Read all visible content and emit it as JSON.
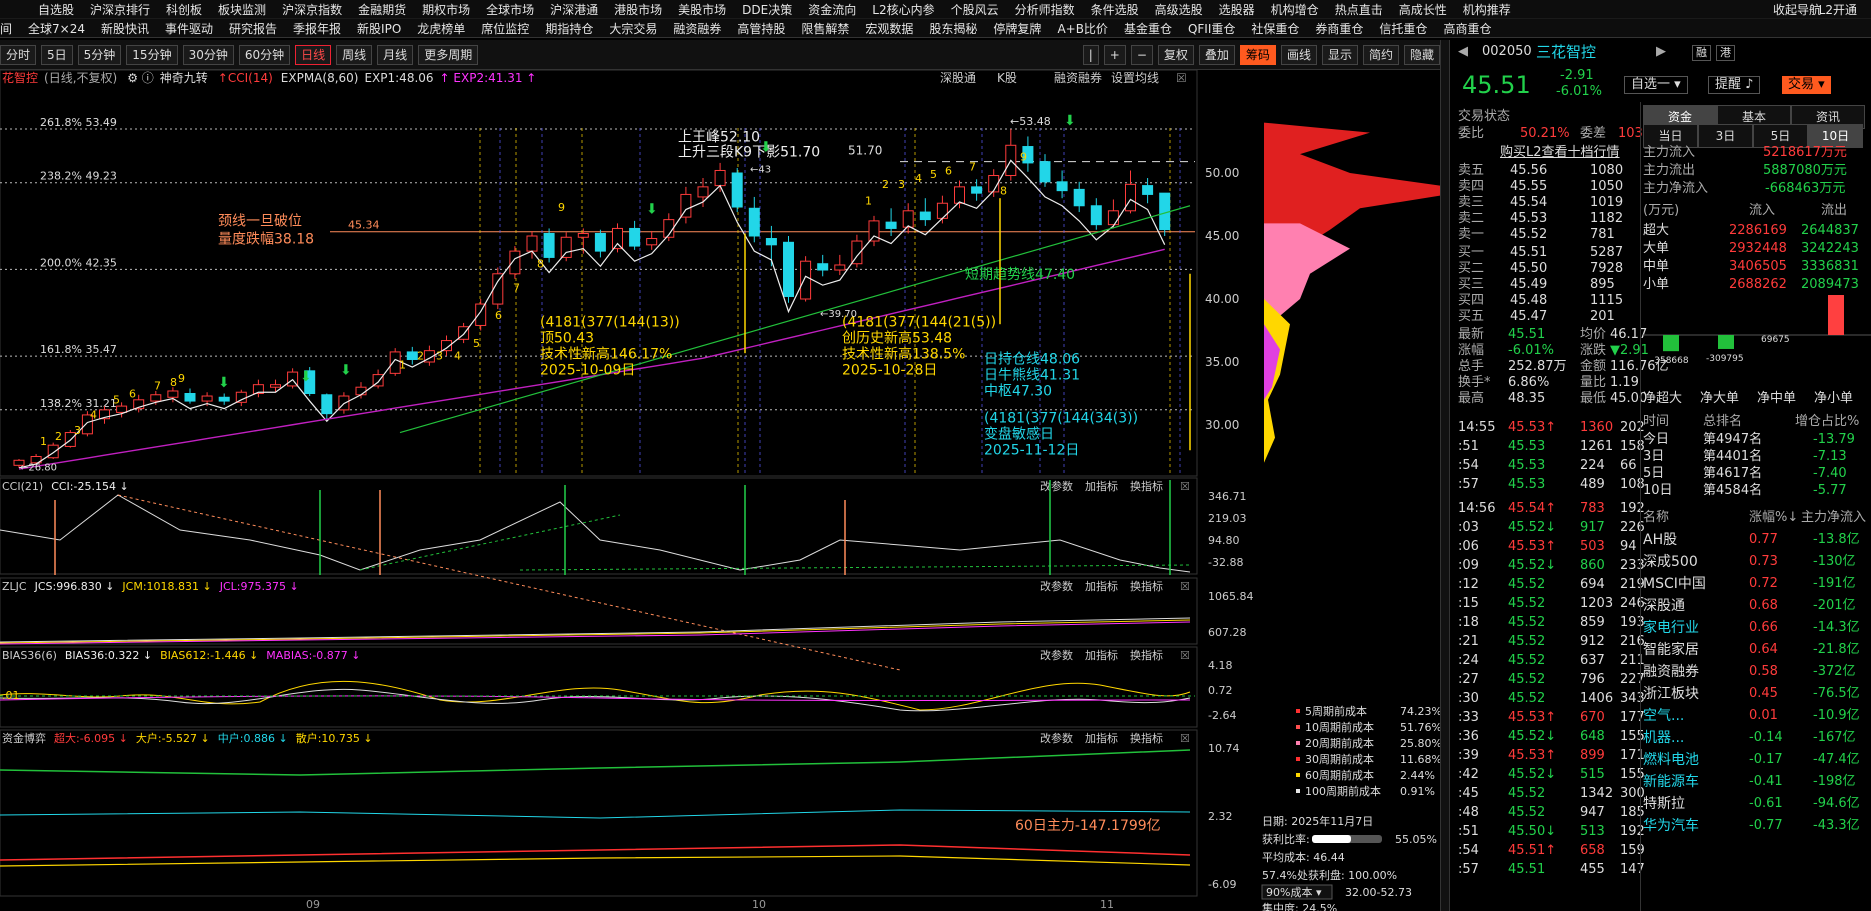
{
  "menu1": [
    "自选股",
    "沪深京排行",
    "科创板",
    "板块监测",
    "沪深京指数",
    "金融期货",
    "期权市场",
    "全球市场",
    "沪深港通",
    "港股市场",
    "美股市场",
    "DDE决策",
    "资金流向",
    "L2核心内参",
    "个股风云",
    "分析师指数",
    "条件选股",
    "高级选股",
    "选股器",
    "机构增仓",
    "热点直击",
    "高成长性",
    "机构推荐"
  ],
  "menu1_right": [
    "收起导航",
    "L2开通"
  ],
  "menu2": [
    "全球7×24",
    "新股快讯",
    "事件驱动",
    "研究报告",
    "季报年报",
    "新股IPO",
    "龙虎榜单",
    "席位监控",
    "期指持仓",
    "大宗交易",
    "融资融券",
    "高管持股",
    "限售解禁",
    "宏观数据",
    "股东揭秘",
    "停牌复牌",
    "A+B比价",
    "基金重仓",
    "QFII重仓",
    "社保重仓",
    "券商重仓",
    "信托重仓",
    "高商重仓"
  ],
  "menu2_left_cut": [
    "间"
  ],
  "toolbar": {
    "items": [
      "分时",
      "5日",
      "5分钟",
      "15分钟",
      "30分钟",
      "60分钟",
      "日线",
      "周线",
      "月线",
      "更多周期"
    ],
    "active": "日线",
    "right": [
      "|",
      "+",
      "−",
      "复权",
      "叠加",
      "筹码",
      "画线",
      "显示",
      "简约",
      "隐藏"
    ],
    "hot": "筹码"
  },
  "chart": {
    "name": "花智控",
    "subtitle": "(日线,不复权)",
    "shenqi": "神奇九转",
    "cci_tag": "CCI(14)",
    "expma": "EXPMA(8,60)",
    "exp1": "EXP1:48.06",
    "exp2": "EXP2:41.31",
    "top_links": [
      "深股通",
      "K股",
      "融资融券",
      "设置均线"
    ],
    "y_labels": [
      "50.00",
      "45.00",
      "40.00",
      "35.00",
      "30.00"
    ],
    "fib": [
      "261.8% 53.49",
      "238.2% 49.23",
      "200.0% 42.35",
      "161.8% 35.47",
      "138.2% 31.21",
      "1.00"
    ],
    "notes": {
      "neck": "颈线一旦破位",
      "neck2": "量度跌幅38.18",
      "neck_val": "45.34",
      "top1": "上王峰52.10",
      "top2": "上升三段K9下影51.70",
      "p5170": "51.70",
      "p5348": "←53.48",
      "sq1": "(4181(377(144(13))",
      "sq1b": "顶50.43",
      "sq1c": "技术性新高146.17%",
      "sq1d": "2025-10-09日",
      "sq2": "(4181(377(144(21(5))",
      "sq2b": "创历史新高53.48",
      "sq2c": "技术性新高138.5%",
      "sq2d": "2025-10-28日",
      "short": "短期趋势线47.40",
      "lines": "日持仓线48.06",
      "lines2": "日牛熊线41.31",
      "lines3": "中枢47.30",
      "sq3": "(4181(377(144(34(3))",
      "sq3b": "变盘敏感日",
      "sq3c": "2025-11-12日",
      "low": "←39.70",
      "low2": "←26.80",
      "p43": "←43"
    },
    "chart_data": {
      "type": "candlestick",
      "x_axis": [
        "09",
        "10",
        "11"
      ],
      "note": "approximate daily candles"
    },
    "cost_legend": [
      [
        "5周期前成本",
        "74.23%"
      ],
      [
        "10周期前成本",
        "51.76%"
      ],
      [
        "20周期前成本",
        "25.80%"
      ],
      [
        "30周期前成本",
        "11.68%"
      ],
      [
        "60周期前成本",
        "2.44%"
      ],
      [
        "100周期前成本",
        "0.91%"
      ]
    ],
    "chip_info": {
      "date": "日期: 2025年11月7日",
      "ratio": "获利比率:",
      "ratio_val": "55.05%",
      "avg": "平均成本: 46.44",
      "range": "57.4%处获利盘: 100.00%",
      "cost90": "90%成本",
      "cost_range": "32.00-52.73",
      "conc": "集中度: 24.5%"
    }
  },
  "panels": [
    {
      "name": "CCI",
      "title": "CCI(21)",
      "vals": [
        {
          "t": "CCI:-25.154",
          "c": "wht"
        }
      ],
      "y": [
        "346.71",
        "219.03",
        "94.80",
        "-32.88"
      ],
      "btn": [
        "改参数",
        "加指标",
        "换指标"
      ]
    },
    {
      "name": "ZLJC",
      "title": "ZLJC",
      "vals": [
        {
          "t": "JCS:996.830",
          "c": "wht"
        },
        {
          "t": "JCM:1018.831",
          "c": "yel"
        },
        {
          "t": "JCL:975.375",
          "c": "mag"
        }
      ],
      "y": [
        "1065.84",
        "607.28"
      ],
      "btn": [
        "改参数",
        "加指标",
        "换指标"
      ]
    },
    {
      "name": "BIAS",
      "title": "BIAS36(6)",
      "vals": [
        {
          "t": "BIAS36:0.322",
          "c": "wht"
        },
        {
          "t": "BIAS612:-1.446",
          "c": "yel"
        },
        {
          "t": "MABIAS:-0.877",
          "c": "mag"
        }
      ],
      "y": [
        "4.18",
        "0.72",
        "-2.64"
      ],
      "btn": [
        "改参数",
        "加指标",
        "换指标"
      ]
    },
    {
      "name": "ZJBY",
      "title": "资金博弈",
      "vals": [
        {
          "t": "超大:-6.095",
          "c": "red"
        },
        {
          "t": "大户:-5.527",
          "c": "yel"
        },
        {
          "t": "中户:0.886",
          "c": "cyn"
        },
        {
          "t": "散户:10.735",
          "c": "yel"
        }
      ],
      "y": [
        "10.74",
        "2.32",
        "-6.09"
      ],
      "btn": [
        "改参数",
        "加指标",
        "换指标"
      ],
      "note": "60日主力-147.1799亿"
    }
  ],
  "stock": {
    "code": "002050",
    "name": "三花智控",
    "tags": [
      "融",
      "港"
    ],
    "price": "45.51",
    "chg": "-2.91",
    "pct": "-6.01%",
    "btn": [
      "自选一",
      "提醒",
      "交易"
    ],
    "status_l": "交易状态",
    "status_r": "已收市",
    "weibi": "委比",
    "weibi_v": "50.21%",
    "weicha": "委差",
    "weicha_v": "10313",
    "l2": "购买L2查看十档行情",
    "asks": [
      [
        "卖五",
        "45.56",
        "1080"
      ],
      [
        "卖四",
        "45.55",
        "1050"
      ],
      [
        "卖三",
        "45.54",
        "1019"
      ],
      [
        "卖二",
        "45.53",
        "1182"
      ],
      [
        "卖一",
        "45.52",
        "781"
      ]
    ],
    "bids": [
      [
        "买一",
        "45.51",
        "5287"
      ],
      [
        "买二",
        "45.50",
        "7928"
      ],
      [
        "买三",
        "45.49",
        "895"
      ],
      [
        "买四",
        "45.48",
        "1115"
      ],
      [
        "买五",
        "45.47",
        "201"
      ]
    ],
    "stats": [
      [
        "最新",
        "45.51",
        "均价",
        "46.17"
      ],
      [
        "涨幅",
        "-6.01%",
        "涨跌",
        "▼2.91"
      ],
      [
        "总手",
        "252.87万",
        "金额",
        "116.76亿"
      ],
      [
        "换手*",
        "6.86%",
        "量比",
        "1.19"
      ],
      [
        "最高",
        "48.35",
        "最低",
        "45.00"
      ]
    ],
    "ticks": [
      [
        "14:55",
        "45.53",
        "↑",
        "1360",
        "202"
      ],
      [
        ":51",
        "45.53",
        "",
        "1261",
        "158"
      ],
      [
        ":54",
        "45.53",
        "",
        "224",
        "66"
      ],
      [
        ":57",
        "45.53",
        "",
        "489",
        "108"
      ],
      [
        "14:56",
        "45.54",
        "↑",
        "783",
        "192"
      ],
      [
        ":03",
        "45.52",
        "↓",
        "917",
        "226"
      ],
      [
        ":06",
        "45.53",
        "↑",
        "503",
        "94"
      ],
      [
        ":09",
        "45.52",
        "↓",
        "860",
        "233"
      ],
      [
        ":12",
        "45.52",
        "",
        "694",
        "219"
      ],
      [
        ":15",
        "45.52",
        "",
        "1203",
        "246"
      ],
      [
        ":18",
        "45.52",
        "",
        "859",
        "193"
      ],
      [
        ":21",
        "45.52",
        "",
        "912",
        "216"
      ],
      [
        ":24",
        "45.52",
        "",
        "637",
        "211"
      ],
      [
        ":27",
        "45.52",
        "",
        "796",
        "227"
      ],
      [
        ":30",
        "45.52",
        "",
        "1406",
        "343"
      ],
      [
        ":33",
        "45.53",
        "↑",
        "670",
        "177"
      ],
      [
        ":36",
        "45.52",
        "↓",
        "648",
        "155"
      ],
      [
        ":39",
        "45.53",
        "↑",
        "899",
        "171"
      ],
      [
        ":42",
        "45.52",
        "↓",
        "515",
        "155"
      ],
      [
        ":45",
        "45.52",
        "",
        "1342",
        "300"
      ],
      [
        ":48",
        "45.52",
        "",
        "947",
        "185"
      ],
      [
        ":51",
        "45.50",
        "↓",
        "513",
        "192"
      ],
      [
        ":54",
        "45.51",
        "↑",
        "658",
        "159"
      ],
      [
        ":57",
        "45.51",
        "",
        "455",
        "147"
      ]
    ]
  },
  "fund": {
    "tabs": [
      "资金",
      "基本",
      "资讯"
    ],
    "sub": [
      "当日",
      "3日",
      "5日",
      "10日"
    ],
    "inflow": "主力流入",
    "inflow_v": "5218617万元",
    "outflow": "主力流出",
    "outflow_v": "5887080万元",
    "net": "主力净流入",
    "net_v": "-668463万元",
    "hdr": [
      "(万元)",
      "流入",
      "流出"
    ],
    "rows": [
      [
        "超大",
        "2286169",
        "2644837"
      ],
      [
        "大单",
        "2932448",
        "3242243"
      ],
      [
        "中单",
        "3406505",
        "3336831"
      ],
      [
        "小单",
        "2688262",
        "2089473"
      ]
    ],
    "bars": [
      "-358668",
      "-309795",
      "69675",
      "598788"
    ],
    "bar_labels": [
      "净超大",
      "净大单",
      "净中单",
      "净小单"
    ],
    "rank_hdr": [
      "时间",
      "总排名",
      "增仓占比%"
    ],
    "rank": [
      [
        "今日",
        "第4947名",
        "-13.79"
      ],
      [
        "3日",
        "第4401名",
        "-7.13"
      ],
      [
        "5日",
        "第4617名",
        "-7.40"
      ],
      [
        "10日",
        "第4584名",
        "-5.77"
      ]
    ],
    "sec_hdr": [
      "名称",
      "涨幅%↓",
      "主力净流入"
    ],
    "sectors": [
      [
        "AH股",
        "0.77",
        "-13.8亿",
        "w"
      ],
      [
        "深成500",
        "0.73",
        "-130亿",
        "w"
      ],
      [
        "MSCI中国",
        "0.72",
        "-191亿",
        "w"
      ],
      [
        "深股通",
        "0.68",
        "-201亿",
        "w"
      ],
      [
        "家电行业",
        "0.66",
        "-14.3亿",
        "c"
      ],
      [
        "智能家居",
        "0.64",
        "-21.8亿",
        "w"
      ],
      [
        "融资融券",
        "0.58",
        "-372亿",
        "w"
      ],
      [
        "浙江板块",
        "0.45",
        "-76.5亿",
        "w"
      ],
      [
        "空气...",
        "0.01",
        "-10.9亿",
        "c"
      ],
      [
        "机器...",
        "-0.14",
        "-167亿",
        "c"
      ],
      [
        "燃料电池",
        "-0.17",
        "-47.4亿",
        "c"
      ],
      [
        "新能源车",
        "-0.41",
        "-198亿",
        "c"
      ],
      [
        "特斯拉",
        "-0.61",
        "-94.6亿",
        "w"
      ],
      [
        "华为汽车",
        "-0.77",
        "-43.3亿",
        "c"
      ]
    ]
  }
}
